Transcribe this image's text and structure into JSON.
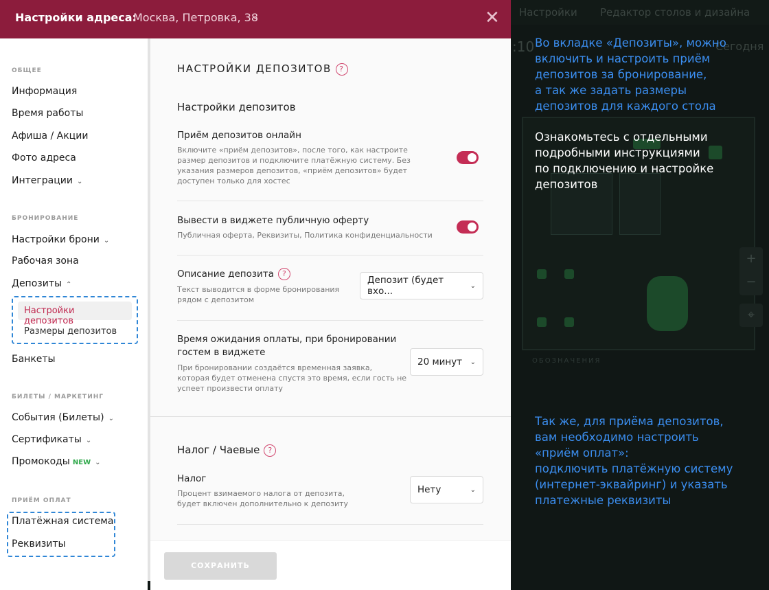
{
  "background": {
    "tab_settings": "Настройки",
    "tab_editor": "Редактор столов и дизайна",
    "time_fragment": ":10",
    "today": "Сегодня",
    "legend_title": "ОБОЗНАЧЕНИЯ"
  },
  "header": {
    "label": "Настройки адреса:",
    "address": "Москва, Петровка, 38",
    "close_icon": "close-icon"
  },
  "sidebar": {
    "sections": {
      "general": "ОБЩЕЕ",
      "booking": "БРОНИРОВАНИЕ",
      "tickets": "БИЛЕТЫ / МАРКЕТИНГ",
      "payments": "ПРИЁМ ОПЛАТ"
    },
    "items": {
      "info": "Информация",
      "hours": "Время работы",
      "afisha": "Афиша / Акции",
      "photo": "Фото адреса",
      "integrations": "Интеграции",
      "booking_settings": "Настройки брони",
      "workzone": "Рабочая зона",
      "deposits": "Депозиты",
      "deposit_settings": "Настройки депозитов",
      "deposit_sizes": "Размеры депозитов",
      "banquets": "Банкеты",
      "events": "События (Билеты)",
      "certificates": "Сертификаты",
      "promocodes": "Промокоды",
      "promocodes_badge": "NEW",
      "payment_system": "Платёжная система",
      "requisites": "Реквизиты"
    }
  },
  "main": {
    "title": "НАСТРОЙКИ ДЕПОЗИТОВ",
    "section_title": "Настройки депозитов",
    "rows": {
      "online": {
        "title": "Приём депозитов онлайн",
        "desc1": "Включите «приём депозитов», после того, как настроите",
        "desc2": "размер депозитов и подключите платёжную систему. Без",
        "desc3": "указания размеров депозитов, «приём депозитов» будет",
        "desc4": "доступен только для хостес",
        "enabled": true
      },
      "offer": {
        "title": "Вывести в виджете публичную оферту",
        "desc": "Публичная оферта, Реквизиты, Политика конфиденциальности",
        "enabled": true
      },
      "description": {
        "title": "Описание депозита",
        "desc1": "Текст выводится в форме бронирования",
        "desc2": "рядом с депозитом",
        "value": "Депозит (будет вхо..."
      },
      "wait": {
        "title1": "Время ожидания оплаты, при бронировании",
        "title2": "гостем в виджете",
        "desc1": "При бронировании создаётся временная заявка,",
        "desc2": "которая будет отменена спустя это время, если гость не",
        "desc3": "успеет произвести оплату",
        "value": "20 минут"
      }
    },
    "tax_section_title": "Налог / Чаевые",
    "tax": {
      "title": "Налог",
      "desc1": "Процент взимаемого налога от депозита,",
      "desc2": "будет включен дополнительно к депозиту",
      "value": "Нету"
    },
    "save_label": "СОХРАНИТЬ"
  },
  "annotations": {
    "a1": [
      "Во вкладке «Депозиты», можно",
      "включить и настроить приём",
      "депозитов за бронирование,",
      "а так же задать размеры",
      "депозитов для каждого стола"
    ],
    "a2": [
      "Ознакомьтесь с отдельными",
      "подробными инструкциями",
      "по подключению и настройке",
      "депозитов"
    ],
    "a3": [
      "Так же, для приёма депозитов,",
      "вам необходимо настроить",
      "«приём оплат»:",
      "подключить платёжную систему",
      "(интернет-эквайринг) и указать",
      "платежные реквизиты"
    ]
  }
}
